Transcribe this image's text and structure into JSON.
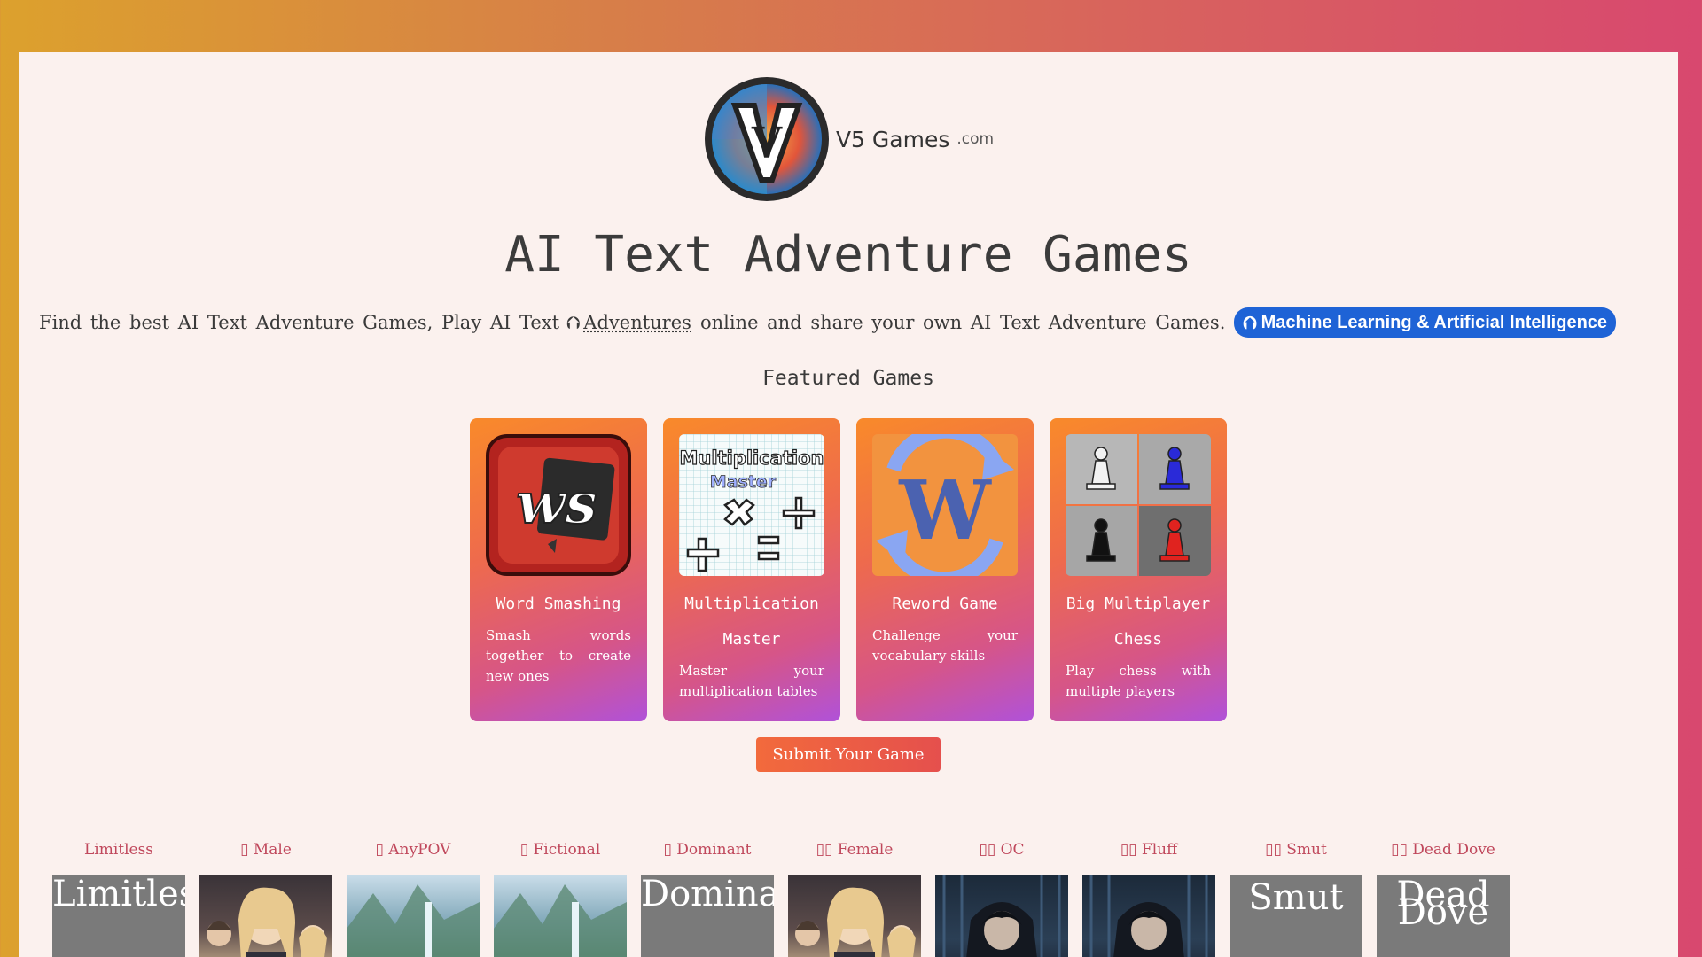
{
  "brand": {
    "name": "V5 Games",
    "tld": ".com",
    "logo_letter": "V"
  },
  "page_title": "AI Text Adventure Games",
  "tagline": {
    "prefix": "Find the best AI Text Adventure Games, Play AI Text",
    "link": "Adventures",
    "suffix": "online and share your own AI Text Adventure Games.",
    "badge": "Machine Learning & Artificial Intelligence"
  },
  "featured": {
    "title": "Featured Games",
    "games": [
      {
        "title": "Word Smashing",
        "desc": "Smash words together to create new ones",
        "thumb": "ws-logo"
      },
      {
        "title": "Multiplication Master",
        "desc": "Master your multiplication tables",
        "thumb": "multiplication-logo",
        "thumb_text": [
          "Multiplication",
          "Master"
        ]
      },
      {
        "title": "Reword Game",
        "desc": "Challenge your vocabulary skills",
        "thumb": "reword-logo",
        "thumb_text": "W"
      },
      {
        "title": "Big Multiplayer Chess",
        "desc": "Play chess with multiple players",
        "thumb": "chess-logo"
      }
    ]
  },
  "submit_label": "Submit Your Game",
  "tags": [
    {
      "label": "Limitless",
      "alt": "Limitless"
    },
    {
      "label": "▯ Male",
      "alt": ""
    },
    {
      "label": "▯ AnyPOV",
      "alt": ""
    },
    {
      "label": "▯ Fictional",
      "alt": ""
    },
    {
      "label": "▯ Dominant",
      "alt": "Dominant"
    },
    {
      "label": "▯▯ Female",
      "alt": ""
    },
    {
      "label": "▯▯ OC",
      "alt": ""
    },
    {
      "label": "▯▯ Fluff",
      "alt": ""
    },
    {
      "label": "▯▯ Smut",
      "alt": "Smut"
    },
    {
      "label": "▯▯ Dead Dove",
      "alt": "Dead Dove"
    }
  ],
  "colors": {
    "accent": "#1e63d6",
    "card_top": "#f98a2a",
    "card_bottom": "#b052d9",
    "tag_label": "#c0485c"
  }
}
